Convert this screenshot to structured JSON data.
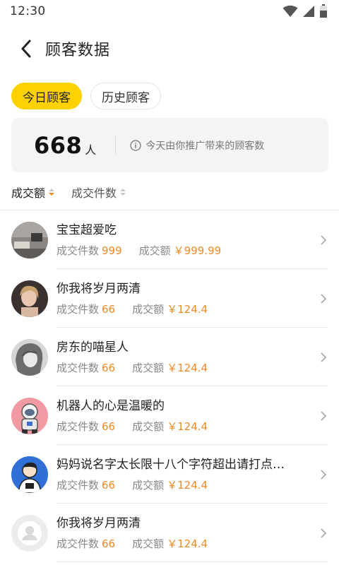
{
  "status_bar": {
    "time": "12:30"
  },
  "header": {
    "title": "顾客数据"
  },
  "tabs": [
    {
      "label": "今日顾客",
      "active": true
    },
    {
      "label": "历史顾客",
      "active": false
    }
  ],
  "summary": {
    "count": "668",
    "unit": "人",
    "hint": "今天由你推广带来的顾客数"
  },
  "sort": [
    {
      "label": "成交额",
      "active": true
    },
    {
      "label": "成交件数",
      "active": false
    }
  ],
  "stats_labels": {
    "count_label": "成交件数",
    "amount_label": "成交额"
  },
  "customers": [
    {
      "name": "宝宝超爱吃",
      "count": "999",
      "amount": "￥999.99",
      "avatar": "room-photo"
    },
    {
      "name": "你我将岁月两清",
      "count": "66",
      "amount": "￥124.4",
      "avatar": "woman-photo"
    },
    {
      "name": "房东的喵星人",
      "count": "66",
      "amount": "￥124.4",
      "avatar": "bw-portrait"
    },
    {
      "name": "机器人的心是温暖的",
      "count": "66",
      "amount": "￥124.4",
      "avatar": "cartoon-astronaut"
    },
    {
      "name": "妈妈说名字太长限十八个字符超出请打点…",
      "count": "66",
      "amount": "￥124.4",
      "avatar": "cartoon-man"
    },
    {
      "name": "你我将岁月两清",
      "count": "66",
      "amount": "￥124.4",
      "avatar": "default-user"
    }
  ],
  "colors": {
    "accent": "#ffd100",
    "value": "#f08a24"
  }
}
